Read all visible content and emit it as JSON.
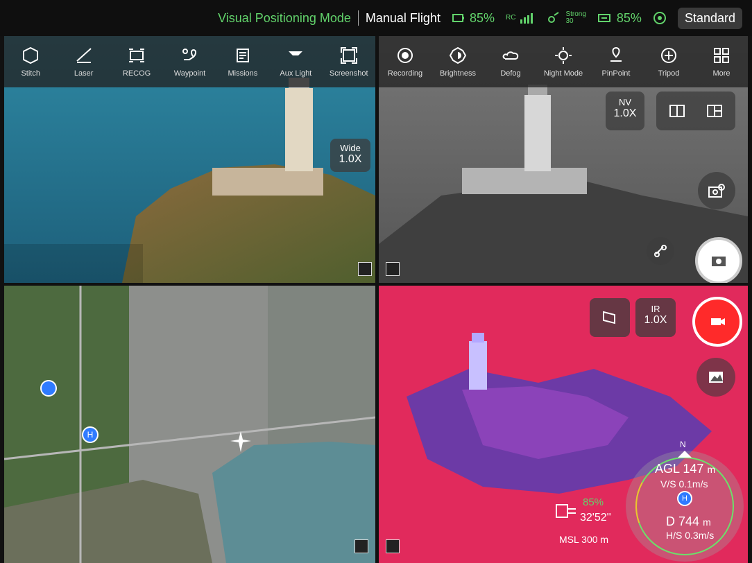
{
  "status": {
    "mode": "Visual Positioning Mode",
    "flight": "Manual Flight",
    "battery1": "85%",
    "signal_label": "RC",
    "signal_strength": "Strong",
    "signal_number": "30",
    "battery2": "85%",
    "profile": "Standard"
  },
  "toolbar_left": [
    {
      "label": "Stitch"
    },
    {
      "label": "Laser"
    },
    {
      "label": "RECOG"
    },
    {
      "label": "Waypoint"
    },
    {
      "label": "Missions"
    },
    {
      "label": "Aux Light"
    },
    {
      "label": "Screenshot"
    }
  ],
  "toolbar_right": [
    {
      "label": "Recording"
    },
    {
      "label": "Brightness"
    },
    {
      "label": "Defog"
    },
    {
      "label": "Night Mode"
    },
    {
      "label": "PinPoint"
    },
    {
      "label": "Tripod"
    },
    {
      "label": "More"
    }
  ],
  "panes": {
    "wide": {
      "title": "Wide",
      "zoom": "1.0X"
    },
    "nv": {
      "title": "NV",
      "zoom": "1.0X"
    },
    "ir": {
      "title": "IR",
      "zoom": "1.0X"
    }
  },
  "telemetry": {
    "agl_label": "AGL",
    "agl_value": "147",
    "agl_unit": "m",
    "vs_label": "V/S",
    "vs_value": "0.1m/s",
    "d_label": "D",
    "d_value": "744",
    "d_unit": "m",
    "hs_label": "H/S",
    "hs_value": "0.3m/s",
    "battery_percent": "85%",
    "time": "32'52''",
    "msl_label": "MSL",
    "msl_value": "300",
    "msl_unit": "m",
    "compass_n": "N",
    "home": "H"
  },
  "map": {
    "home": "H"
  },
  "colors": {
    "green": "#62d36b",
    "record": "#ff2a2a"
  }
}
